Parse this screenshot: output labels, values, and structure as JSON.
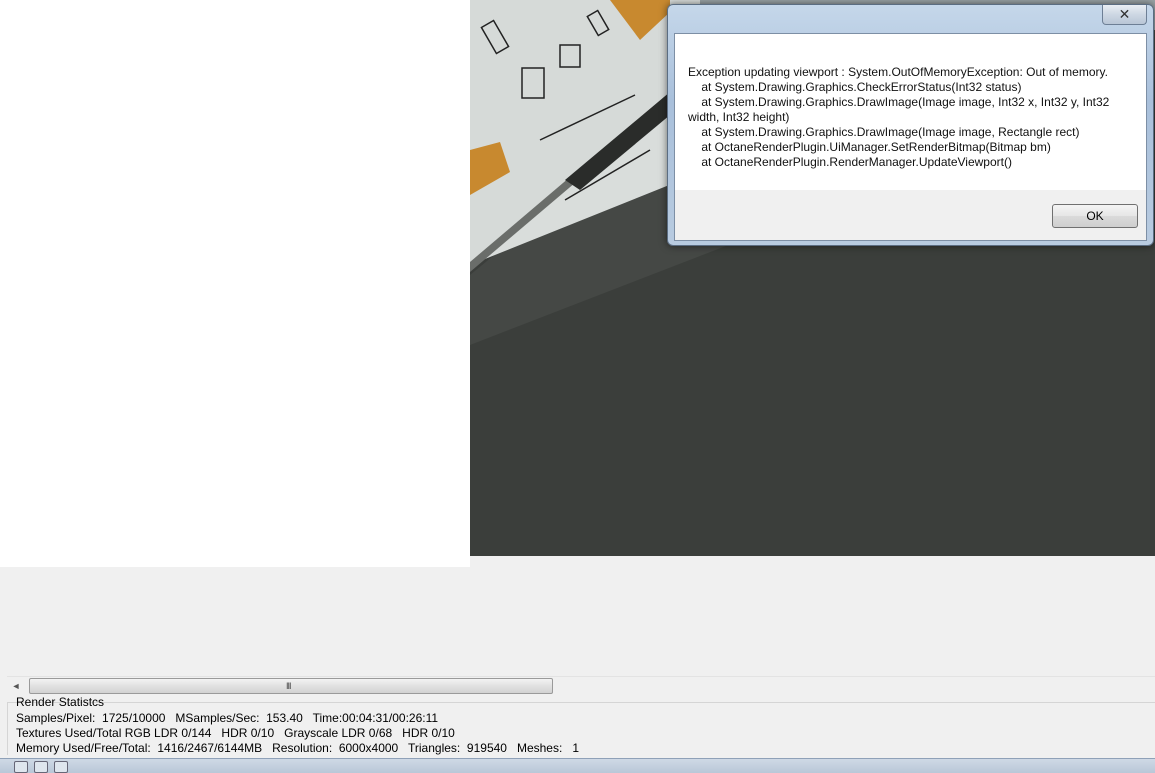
{
  "dialog": {
    "close_label": "✕",
    "message": "Exception updating viewport : System.OutOfMemoryException: Out of memory.\n    at System.Drawing.Graphics.CheckErrorStatus(Int32 status)\n    at System.Drawing.Graphics.DrawImage(Image image, Int32 x, Int32 y, Int32 width, Int32 height)\n    at System.Drawing.Graphics.DrawImage(Image image, Rectangle rect)\n    at OctaneRenderPlugin.UiManager.SetRenderBitmap(Bitmap bm)\n    at OctaneRenderPlugin.RenderManager.UpdateViewport()",
    "ok_label": "OK"
  },
  "scrollbar": {
    "left_arrow": "◄",
    "grip": "III"
  },
  "stats": {
    "title": "Render Statistcs",
    "line1": "Samples/Pixel:  1725/10000   MSamples/Sec:  153.40   Time:00:04:31/00:26:11",
    "line2": "Textures Used/Total RGB LDR 0/144   HDR 0/10   Grayscale LDR 0/68   HDR 0/10",
    "line3": "Memory Used/Free/Total:  1416/2467/6144MB   Resolution:  6000x4000   Triangles:  919540   Meshes:   1"
  },
  "colors": {
    "viewport_bg": "#3b3e3b",
    "floor": "#d9dddb",
    "wood": "#c8892f"
  }
}
